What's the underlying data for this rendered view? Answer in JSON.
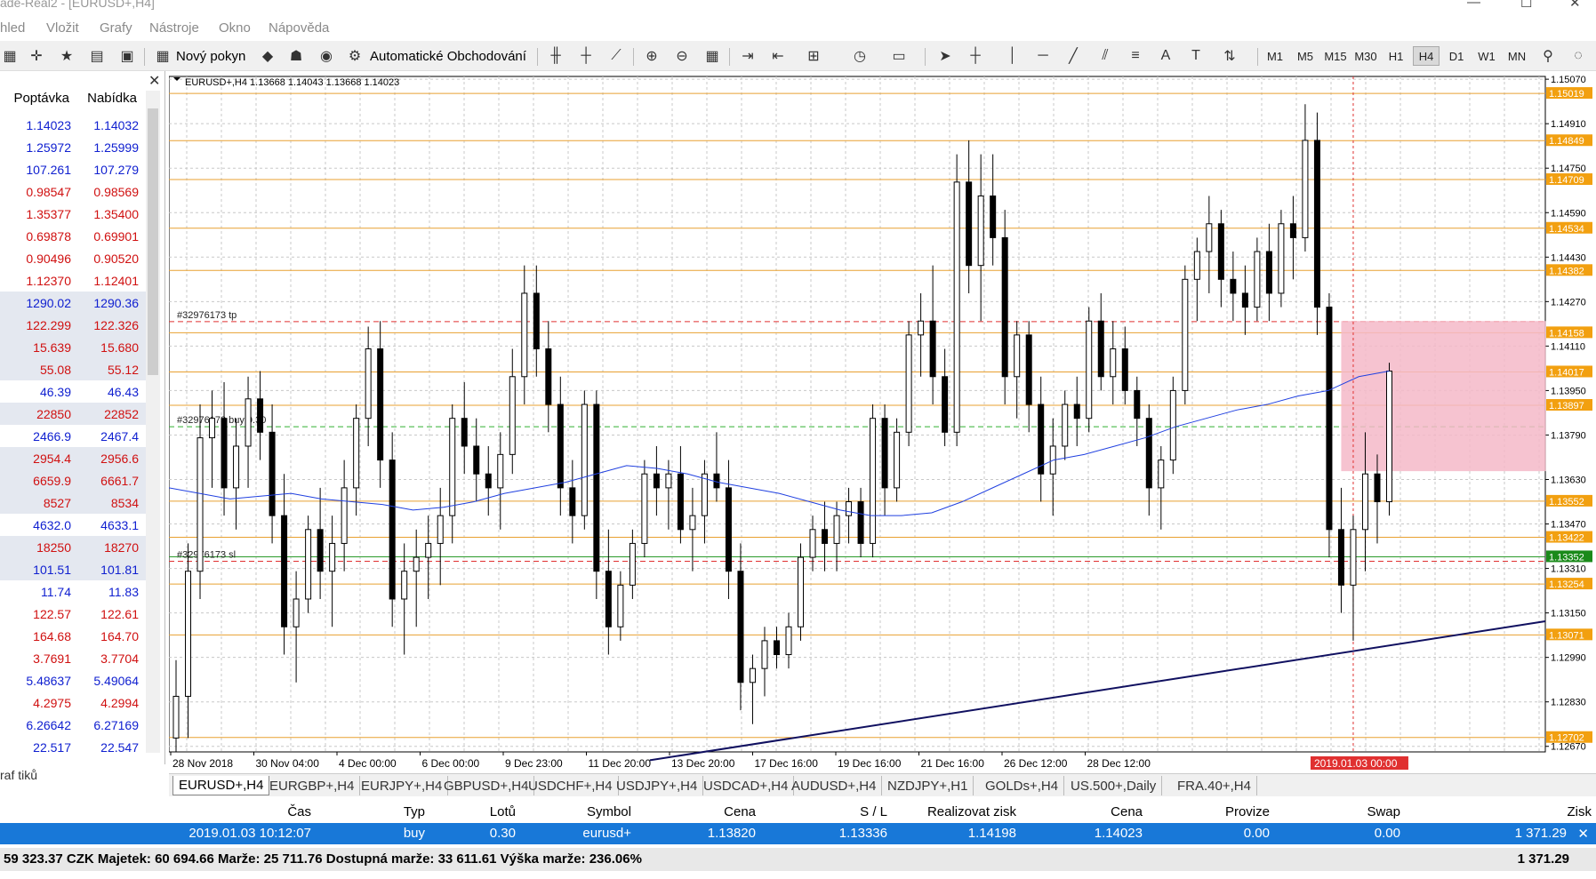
{
  "window": {
    "title": "ade-Real2 - [EURUSD+,H4]"
  },
  "menu": [
    "hled",
    "Vložit",
    "Grafy",
    "Nástroje",
    "Okno",
    "Nápověda"
  ],
  "toolbar": {
    "new_order": "Nový pokyn",
    "auto_trading": "Automatické Obchodování",
    "text_tool": "A",
    "timeframes": [
      "M1",
      "M5",
      "M15",
      "M30",
      "H1",
      "H4",
      "D1",
      "W1",
      "MN"
    ],
    "active_timeframe": "H4"
  },
  "watchlist": {
    "col_bid": "Poptávka",
    "col_ask": "Nabídka",
    "footer_tab": "raf tiků",
    "rows": [
      {
        "bid": "1.14023",
        "ask": "1.14032",
        "color": "blue"
      },
      {
        "bid": "1.25972",
        "ask": "1.25999",
        "color": "blue"
      },
      {
        "bid": "107.261",
        "ask": "107.279",
        "color": "blue"
      },
      {
        "bid": "0.98547",
        "ask": "0.98569",
        "color": "red"
      },
      {
        "bid": "1.35377",
        "ask": "1.35400",
        "color": "red"
      },
      {
        "bid": "0.69878",
        "ask": "0.69901",
        "color": "red"
      },
      {
        "bid": "0.90496",
        "ask": "0.90520",
        "color": "red"
      },
      {
        "bid": "1.12370",
        "ask": "1.12401",
        "color": "red"
      },
      {
        "bid": "1290.02",
        "ask": "1290.36",
        "color": "blue"
      },
      {
        "bid": "122.299",
        "ask": "122.326",
        "color": "red"
      },
      {
        "bid": "15.639",
        "ask": "15.680",
        "color": "red"
      },
      {
        "bid": "55.08",
        "ask": "55.12",
        "color": "red"
      },
      {
        "bid": "46.39",
        "ask": "46.43",
        "color": "blue"
      },
      {
        "bid": "22850",
        "ask": "22852",
        "color": "red"
      },
      {
        "bid": "2466.9",
        "ask": "2467.4",
        "color": "blue"
      },
      {
        "bid": "2954.4",
        "ask": "2956.6",
        "color": "red"
      },
      {
        "bid": "6659.9",
        "ask": "6661.7",
        "color": "red"
      },
      {
        "bid": "8527",
        "ask": "8534",
        "color": "red"
      },
      {
        "bid": "4632.0",
        "ask": "4633.1",
        "color": "blue"
      },
      {
        "bid": "18250",
        "ask": "18270",
        "color": "red"
      },
      {
        "bid": "101.51",
        "ask": "101.81",
        "color": "blue"
      },
      {
        "bid": "11.74",
        "ask": "11.83",
        "color": "blue"
      },
      {
        "bid": "122.57",
        "ask": "122.61",
        "color": "red"
      },
      {
        "bid": "164.68",
        "ask": "164.70",
        "color": "red"
      },
      {
        "bid": "3.7691",
        "ask": "3.7704",
        "color": "red"
      },
      {
        "bid": "5.48637",
        "ask": "5.49064",
        "color": "blue"
      },
      {
        "bid": "4.2975",
        "ask": "4.2994",
        "color": "red"
      },
      {
        "bid": "6.26642",
        "ask": "6.27169",
        "color": "blue"
      },
      {
        "bid": "22.517",
        "ask": "22.547",
        "color": "blue"
      }
    ]
  },
  "chart": {
    "header": "EURUSD+,H4  1.13668 1.14043 1.13668 1.14023",
    "order_tp_label": "#32976173 tp",
    "order_buy_label": "#32976173 buy 0.30",
    "order_sl_label": "#32976173 sl",
    "current_time_label": "2019.01.03 00:00",
    "colors": {
      "bg": "#ffffff",
      "grid": "#c8c8c8",
      "candle": "#000000",
      "level": "#e8a030",
      "ma": "#2040e0",
      "trend": "#101060",
      "box": "#f4b8c8"
    }
  },
  "chart_data": {
    "type": "candlestick",
    "symbol": "EURUSD+",
    "timeframe": "H4",
    "ylim": [
      1.1265,
      1.1508
    ],
    "y_ticks": [
      "1.15070",
      "1.14910",
      "1.14750",
      "1.14590",
      "1.14430",
      "1.14270",
      "1.14110",
      "1.13950",
      "1.13790",
      "1.13630",
      "1.13470",
      "1.13310",
      "1.13150",
      "1.12990",
      "1.12830",
      "1.12670"
    ],
    "x_labels": [
      "28 Nov 2018",
      "30 Nov 04:00",
      "4 Dec 00:00",
      "6 Dec 00:00",
      "9 Dec 23:00",
      "11 Dec 20:00",
      "13 Dec 20:00",
      "17 Dec 16:00",
      "19 Dec 16:00",
      "21 Dec 16:00",
      "26 Dec 12:00",
      "28 Dec 12:00"
    ],
    "price_levels": [
      "1.15019",
      "1.14849",
      "1.14709",
      "1.14534",
      "1.14382",
      "1.14158",
      "1.14017",
      "1.13897",
      "1.13552",
      "1.13422",
      "1.13352",
      "1.13254",
      "1.13071",
      "1.12702"
    ],
    "current_price_label": "1.14017",
    "sl_price_label": "1.13352",
    "order": {
      "tp": 1.14198,
      "open": 1.1382,
      "sl": 1.13336
    },
    "candles": [
      [
        1.127,
        1.1298,
        1.1265,
        1.1285
      ],
      [
        1.1285,
        1.134,
        1.127,
        1.133
      ],
      [
        1.133,
        1.139,
        1.132,
        1.1378
      ],
      [
        1.1378,
        1.1395,
        1.136,
        1.1385
      ],
      [
        1.1385,
        1.1398,
        1.135,
        1.136
      ],
      [
        1.136,
        1.1385,
        1.1345,
        1.1375
      ],
      [
        1.1375,
        1.14,
        1.136,
        1.1392
      ],
      [
        1.1392,
        1.1402,
        1.137,
        1.138
      ],
      [
        1.138,
        1.139,
        1.134,
        1.135
      ],
      [
        1.135,
        1.1365,
        1.13,
        1.131
      ],
      [
        1.131,
        1.133,
        1.129,
        1.132
      ],
      [
        1.132,
        1.135,
        1.1315,
        1.1345
      ],
      [
        1.1345,
        1.136,
        1.132,
        1.133
      ],
      [
        1.133,
        1.135,
        1.131,
        1.134
      ],
      [
        1.134,
        1.137,
        1.133,
        1.136
      ],
      [
        1.136,
        1.139,
        1.135,
        1.1385
      ],
      [
        1.1385,
        1.1418,
        1.1375,
        1.141
      ],
      [
        1.141,
        1.142,
        1.136,
        1.137
      ],
      [
        1.137,
        1.138,
        1.131,
        1.132
      ],
      [
        1.132,
        1.134,
        1.13,
        1.133
      ],
      [
        1.133,
        1.1345,
        1.131,
        1.1335
      ],
      [
        1.1335,
        1.135,
        1.132,
        1.134
      ],
      [
        1.134,
        1.136,
        1.1325,
        1.135
      ],
      [
        1.135,
        1.139,
        1.134,
        1.1385
      ],
      [
        1.1385,
        1.1398,
        1.1365,
        1.1375
      ],
      [
        1.1375,
        1.1385,
        1.1355,
        1.1365
      ],
      [
        1.1365,
        1.1375,
        1.135,
        1.136
      ],
      [
        1.136,
        1.138,
        1.1345,
        1.1372
      ],
      [
        1.1372,
        1.141,
        1.1365,
        1.14
      ],
      [
        1.14,
        1.144,
        1.139,
        1.143
      ],
      [
        1.143,
        1.144,
        1.14,
        1.141
      ],
      [
        1.141,
        1.142,
        1.138,
        1.139
      ],
      [
        1.139,
        1.14,
        1.135,
        1.136
      ],
      [
        1.136,
        1.137,
        1.134,
        1.135
      ],
      [
        1.135,
        1.1395,
        1.1345,
        1.139
      ],
      [
        1.139,
        1.1395,
        1.132,
        1.133
      ],
      [
        1.133,
        1.1345,
        1.13,
        1.131
      ],
      [
        1.131,
        1.133,
        1.1305,
        1.1325
      ],
      [
        1.1325,
        1.1345,
        1.132,
        1.134
      ],
      [
        1.134,
        1.137,
        1.1335,
        1.1365
      ],
      [
        1.1365,
        1.1375,
        1.135,
        1.136
      ],
      [
        1.136,
        1.137,
        1.1345,
        1.1365
      ],
      [
        1.1365,
        1.1375,
        1.134,
        1.1345
      ],
      [
        1.1345,
        1.136,
        1.133,
        1.135
      ],
      [
        1.135,
        1.137,
        1.134,
        1.1365
      ],
      [
        1.1365,
        1.138,
        1.1355,
        1.136
      ],
      [
        1.136,
        1.137,
        1.132,
        1.133
      ],
      [
        1.133,
        1.134,
        1.128,
        1.129
      ],
      [
        1.129,
        1.13,
        1.1275,
        1.1295
      ],
      [
        1.1295,
        1.131,
        1.1285,
        1.1305
      ],
      [
        1.1305,
        1.131,
        1.1295,
        1.13
      ],
      [
        1.13,
        1.1315,
        1.1295,
        1.131
      ],
      [
        1.131,
        1.134,
        1.1305,
        1.1335
      ],
      [
        1.1335,
        1.135,
        1.133,
        1.1345
      ],
      [
        1.1345,
        1.1355,
        1.133,
        1.134
      ],
      [
        1.134,
        1.1355,
        1.133,
        1.135
      ],
      [
        1.135,
        1.136,
        1.134,
        1.1355
      ],
      [
        1.1355,
        1.136,
        1.1335,
        1.134
      ],
      [
        1.134,
        1.139,
        1.1335,
        1.1385
      ],
      [
        1.1385,
        1.139,
        1.135,
        1.136
      ],
      [
        1.136,
        1.1385,
        1.1355,
        1.138
      ],
      [
        1.138,
        1.142,
        1.1375,
        1.1415
      ],
      [
        1.1415,
        1.143,
        1.14,
        1.142
      ],
      [
        1.142,
        1.144,
        1.139,
        1.14
      ],
      [
        1.14,
        1.141,
        1.1375,
        1.138
      ],
      [
        1.138,
        1.148,
        1.1375,
        1.147
      ],
      [
        1.147,
        1.1485,
        1.143,
        1.144
      ],
      [
        1.144,
        1.148,
        1.142,
        1.1465
      ],
      [
        1.1465,
        1.148,
        1.144,
        1.145
      ],
      [
        1.145,
        1.146,
        1.139,
        1.14
      ],
      [
        1.14,
        1.142,
        1.1385,
        1.1415
      ],
      [
        1.1415,
        1.142,
        1.138,
        1.139
      ],
      [
        1.139,
        1.14,
        1.1355,
        1.1365
      ],
      [
        1.1365,
        1.1385,
        1.135,
        1.1375
      ],
      [
        1.1375,
        1.1395,
        1.137,
        1.139
      ],
      [
        1.139,
        1.14,
        1.1375,
        1.1385
      ],
      [
        1.1385,
        1.1425,
        1.138,
        1.142
      ],
      [
        1.142,
        1.143,
        1.1395,
        1.14
      ],
      [
        1.14,
        1.142,
        1.139,
        1.141
      ],
      [
        1.141,
        1.1418,
        1.139,
        1.1395
      ],
      [
        1.1395,
        1.14,
        1.1375,
        1.1385
      ],
      [
        1.1385,
        1.139,
        1.135,
        1.136
      ],
      [
        1.136,
        1.1375,
        1.1345,
        1.137
      ],
      [
        1.137,
        1.14,
        1.1365,
        1.1395
      ],
      [
        1.1395,
        1.144,
        1.139,
        1.1435
      ],
      [
        1.1435,
        1.145,
        1.142,
        1.1445
      ],
      [
        1.1445,
        1.1465,
        1.143,
        1.1455
      ],
      [
        1.1455,
        1.146,
        1.1425,
        1.1435
      ],
      [
        1.1435,
        1.1445,
        1.142,
        1.143
      ],
      [
        1.143,
        1.144,
        1.1415,
        1.1425
      ],
      [
        1.1425,
        1.145,
        1.142,
        1.1445
      ],
      [
        1.1445,
        1.1455,
        1.142,
        1.143
      ],
      [
        1.143,
        1.146,
        1.1425,
        1.1455
      ],
      [
        1.1455,
        1.1465,
        1.1435,
        1.145
      ],
      [
        1.145,
        1.1498,
        1.1445,
        1.1485
      ],
      [
        1.1485,
        1.1495,
        1.1415,
        1.1425
      ],
      [
        1.1425,
        1.143,
        1.1335,
        1.1345
      ],
      [
        1.1345,
        1.136,
        1.1315,
        1.1325
      ],
      [
        1.1325,
        1.135,
        1.1305,
        1.1345
      ],
      [
        1.1345,
        1.138,
        1.133,
        1.1365
      ],
      [
        1.1365,
        1.1372,
        1.134,
        1.1355
      ],
      [
        1.1355,
        1.1405,
        1.135,
        1.1402
      ]
    ],
    "ma": [
      1.136,
      1.1358,
      1.1356,
      1.1357,
      1.1358,
      1.1356,
      1.1355,
      1.1354,
      1.1352,
      1.1353,
      1.1355,
      1.1358,
      1.136,
      1.1362,
      1.1365,
      1.1368,
      1.1367,
      1.1365,
      1.1362,
      1.136,
      1.1358,
      1.1355,
      1.1352,
      1.135,
      1.135,
      1.1351,
      1.1355,
      1.136,
      1.1365,
      1.137,
      1.1372,
      1.1375,
      1.1378,
      1.1382,
      1.1385,
      1.1388,
      1.139,
      1.1393,
      1.1395,
      1.14,
      1.1402
    ]
  },
  "chart_tabs": [
    "EURUSD+,H4",
    "EURGBP+,H4",
    "EURJPY+,H4",
    "GBPUSD+,H4",
    "USDCHF+,H4",
    "USDJPY+,H4",
    "USDCAD+,H4",
    "AUDUSD+,H4",
    "NZDJPY+,H1",
    "GOLDs+,H4",
    "US.500+,Daily",
    "FRA.40+,H4"
  ],
  "terminal": {
    "headers": [
      "Čas",
      "Typ",
      "Lotů",
      "Symbol",
      "Cena",
      "S / L",
      "Realizovat zisk",
      "Cena",
      "Provize",
      "Swap",
      "Zisk"
    ],
    "row": [
      "2019.01.03 10:12:07",
      "buy",
      "0.30",
      "eurusd+",
      "1.13820",
      "1.13336",
      "1.14198",
      "1.14023",
      "0.00",
      "0.00",
      "1 371.29"
    ],
    "summary": "59 323.37 CZK  Majetek: 60 694.66  Marže: 25 711.76  Dostupná marže: 33 611.61  Výška marže: 236.06%",
    "summary_profit": "1 371.29"
  }
}
